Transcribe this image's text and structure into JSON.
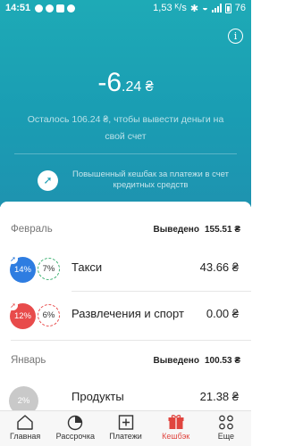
{
  "status_bar": {
    "time": "14:51",
    "speed": "1,53 ᴷ/s",
    "battery": "76"
  },
  "header": {
    "amount_main": "-6",
    "amount_fraction": ".24 ₴",
    "hint": "Осталось 106.24 ₴, чтобы вывести деньги на свой счет",
    "promo_text": "Повышенный кешбак за платежи в счет кредитных средств",
    "promo_icon": "arrow-icon",
    "colors": {
      "top": "#1eaab6",
      "bottom": "#1e93b0"
    }
  },
  "months": [
    {
      "name": "Февраль",
      "withdrawn_label": "Выведено",
      "withdrawn_value": "155.51 ₴",
      "items": [
        {
          "pct_main": "14%",
          "pct_secondary": "7%",
          "label": "Такси",
          "value": "43.66 ₴",
          "color": "#2e7de1"
        },
        {
          "pct_main": "12%",
          "pct_secondary": "6%",
          "label": "Развлечения и спорт",
          "value": "0.00 ₴",
          "color": "#e84b4b"
        }
      ]
    },
    {
      "name": "Январь",
      "withdrawn_label": "Выведено",
      "withdrawn_value": "100.53 ₴",
      "items": [
        {
          "pct_main": "2%",
          "label": "Продукты",
          "value": "21.38 ₴",
          "color": "#c9c9c9"
        }
      ]
    }
  ],
  "nav": [
    {
      "label": "Главная",
      "icon": "home-icon"
    },
    {
      "label": "Рассрочка",
      "icon": "pie-chart-icon"
    },
    {
      "label": "Платежи",
      "icon": "plus-box-icon"
    },
    {
      "label": "Кешбэк",
      "icon": "gift-icon",
      "active": true
    },
    {
      "label": "Еще",
      "icon": "more-icon"
    }
  ]
}
